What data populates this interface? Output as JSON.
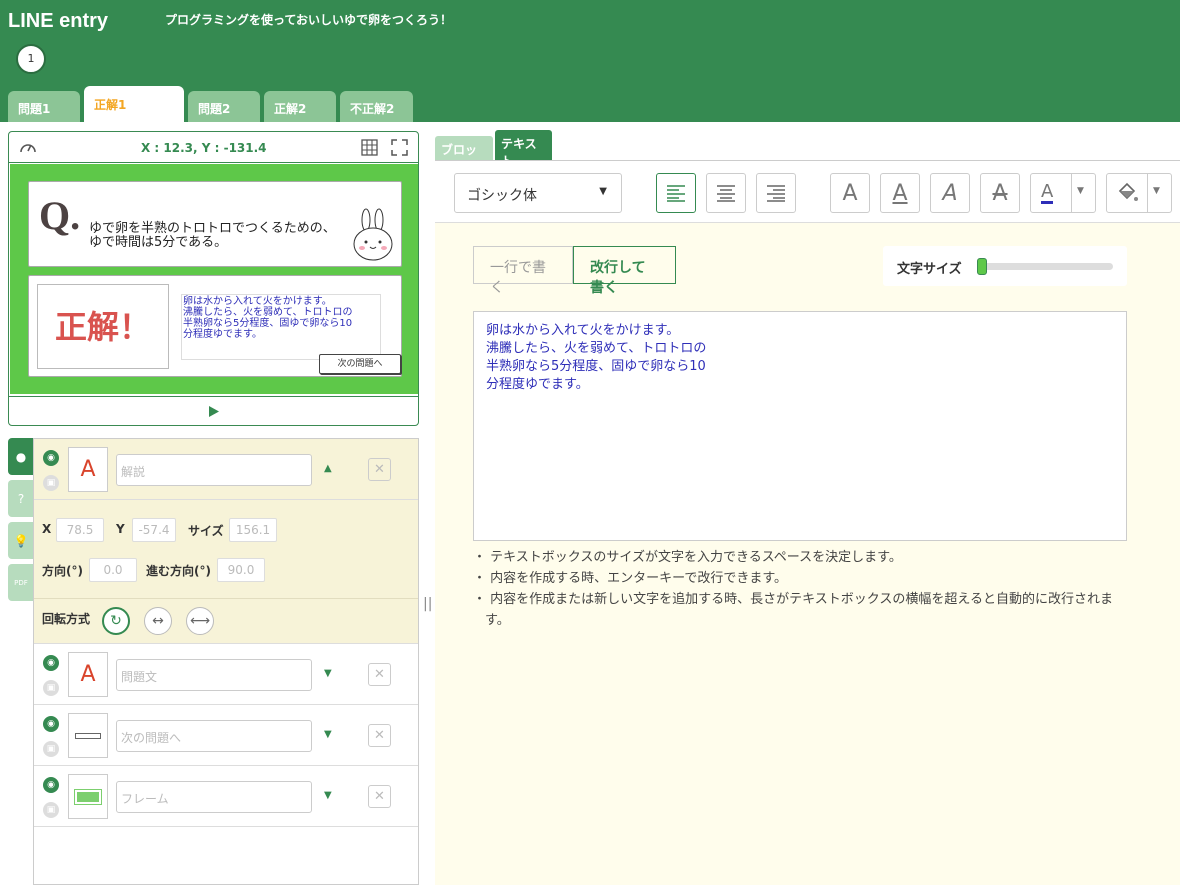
{
  "app": {
    "logo": "LINE entry",
    "project_title": "プログラミングを使っておいしいゆで卵をつくろう！",
    "scene_number": "1"
  },
  "scene_tabs": [
    "問題1",
    "正解1",
    "問題2",
    "正解2",
    "不正解2"
  ],
  "stage": {
    "coord": "X : 12.3, Y : -131.4",
    "q_letter": "Q.",
    "question": "ゆで卵を半熟のトロトロでつくるための、\nゆで時間は5分である。",
    "answer": "正解！",
    "explanation": "卵は水から入れて火をかけます。\n沸騰したら、火を弱めて、トロトロの\n半熟卵なら5分程度、固ゆで卵なら10\n分程度ゆでます。",
    "next_button": "次の問題へ"
  },
  "objects": [
    {
      "name": "解説",
      "thumb": "A"
    },
    {
      "name": "問題文",
      "thumb": "A"
    },
    {
      "name": "次の問題へ",
      "thumb": ""
    },
    {
      "name": "フレーム",
      "thumb": ""
    }
  ],
  "props": {
    "x_label": "X",
    "x": "78.5",
    "y_label": "Y",
    "y": "-57.4",
    "size_label": "サイズ",
    "size": "156.1",
    "dir_label": "方向(°)",
    "dir": "0.0",
    "move_label": "進む方向(°)",
    "move": "90.0",
    "rot_label": "回転方式"
  },
  "right": {
    "tab_block": "ブロック",
    "tab_text": "テキスト",
    "font": "ゴシック体",
    "mode_single": "一行で書く",
    "mode_multi": "改行して書く",
    "size_label": "文字サイズ",
    "text": "卵は水から入れて火をかけます。\n沸騰したら、火を弱めて、トロトロの\n半熟卵なら5分程度、固ゆで卵なら10\n分程度ゆでます。",
    "notes": [
      "テキストボックスのサイズが文字を入力できるスペースを決定します。",
      "内容を作成する時、エンターキーで改行できます。",
      "内容を作成または新しい文字を追加する時、長さがテキストボックスの横幅を超えると自動的に改行されます。"
    ]
  },
  "colors": {
    "header": "#358a51",
    "stage_bg": "#5ec849",
    "accent_tab": "#f3a623",
    "text_blue": "#2e2eb8"
  }
}
